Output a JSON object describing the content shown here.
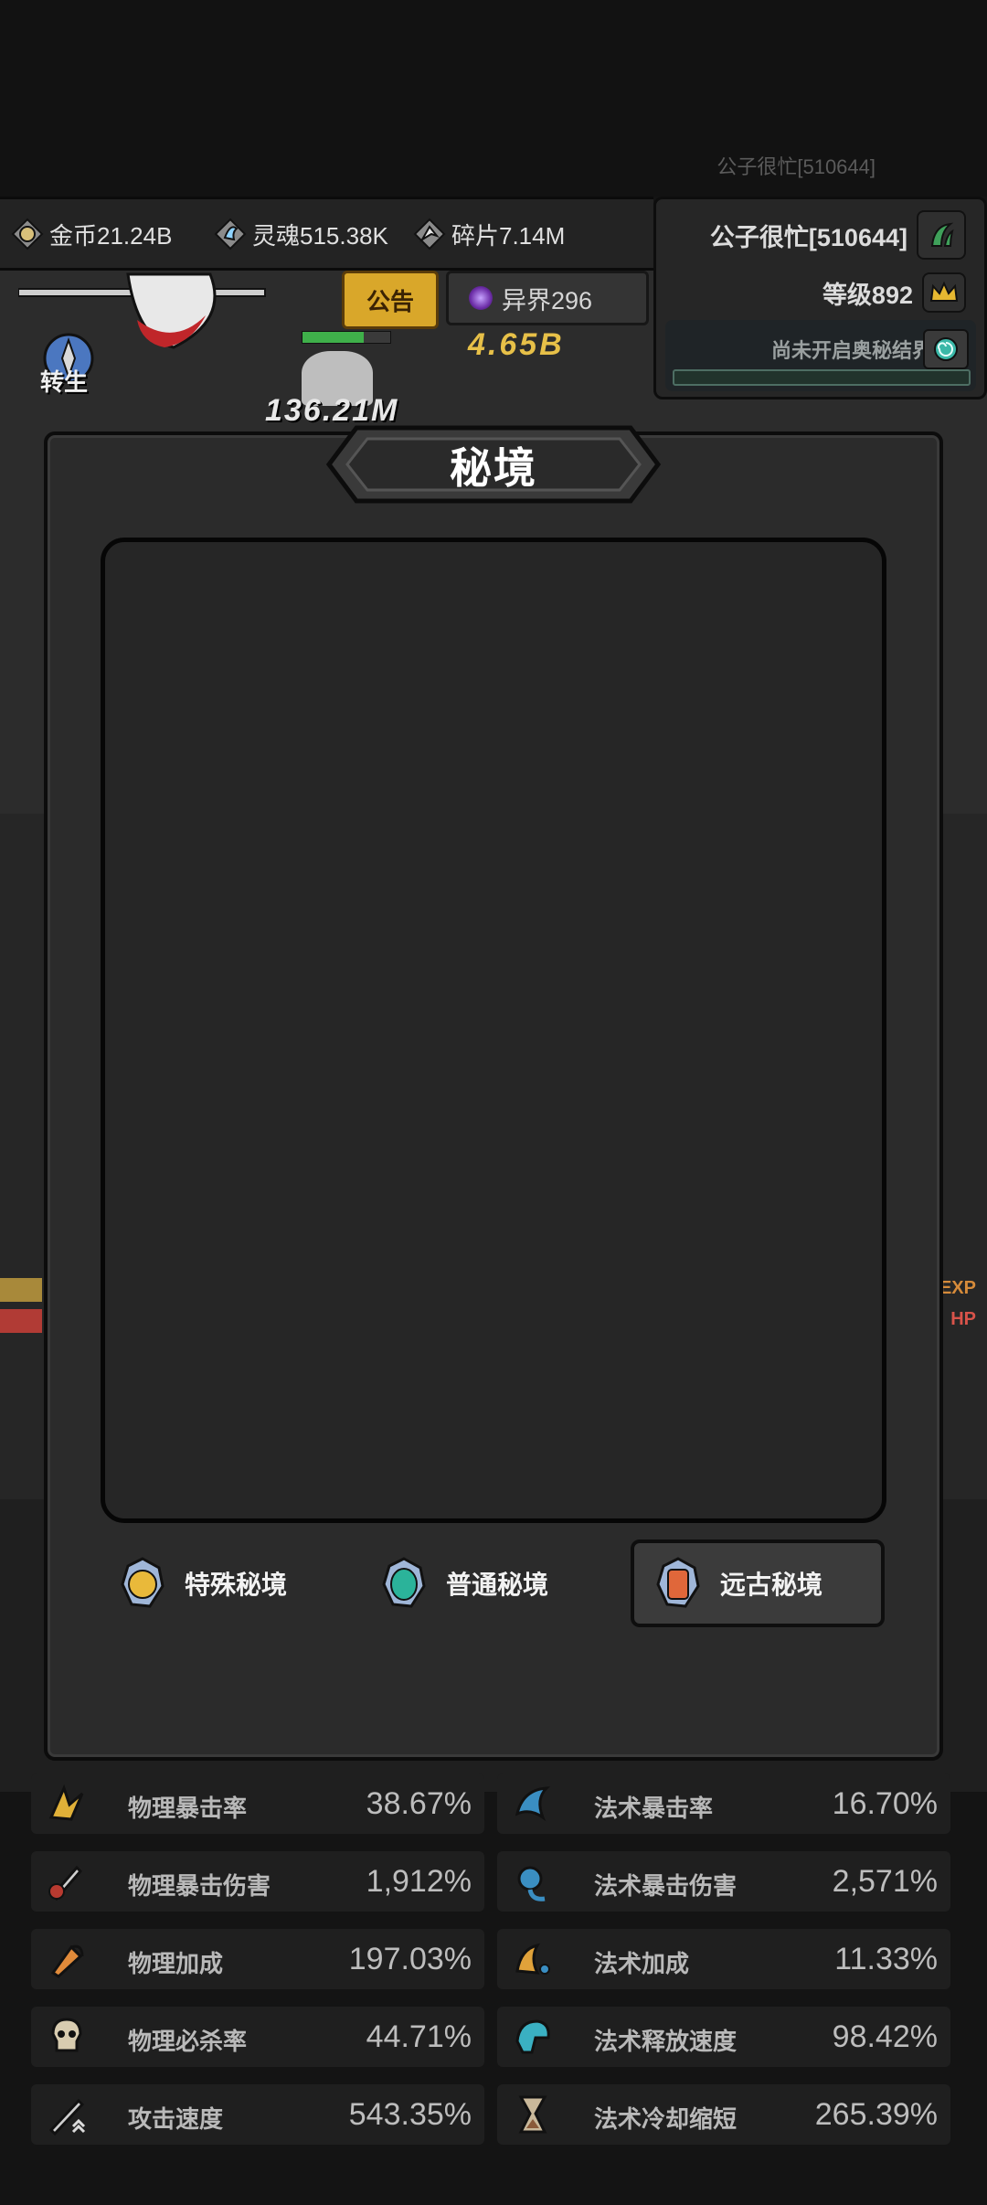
{
  "header": {
    "player_name_faint": "公子很忙[510644]"
  },
  "resources": [
    {
      "name": "gold",
      "label": "金币21.24B",
      "icon": "coin-icon"
    },
    {
      "name": "soul",
      "label": "灵魂515.38K",
      "icon": "soul-icon"
    },
    {
      "name": "shards",
      "label": "碎片7.14M",
      "icon": "shard-icon"
    }
  ],
  "player_panel": {
    "name": "公子很忙[510644]",
    "level": "等级892",
    "secret_realm_status": "尚未开启奥秘结界"
  },
  "scene": {
    "notice_label": "公告",
    "otherworld_label": "异界296",
    "damage_number": "4.65B",
    "big_damage": "136.21M",
    "rebirth_label": "转生",
    "exp_label": "EXP",
    "hp_label": "HP"
  },
  "modal": {
    "title": "秘境",
    "tabs": [
      {
        "label": "特殊秘境",
        "gem": "gold",
        "selected": false
      },
      {
        "label": "普通秘境",
        "gem": "teal",
        "selected": false
      },
      {
        "label": "远古秘境",
        "gem": "orange",
        "selected": true
      }
    ]
  },
  "stats": [
    {
      "label": "物理暴击率",
      "value": "38.67%",
      "icon": "physical-crit-icon"
    },
    {
      "label": "法术暴击率",
      "value": "16.70%",
      "icon": "spell-crit-icon"
    },
    {
      "label": "物理暴击伤害",
      "value": "1,912%",
      "icon": "physical-crit-damage-icon"
    },
    {
      "label": "法术暴击伤害",
      "value": "2,571%",
      "icon": "spell-crit-damage-icon"
    },
    {
      "label": "物理加成",
      "value": "197.03%",
      "icon": "physical-bonus-icon"
    },
    {
      "label": "法术加成",
      "value": "11.33%",
      "icon": "spell-bonus-icon"
    },
    {
      "label": "物理必杀率",
      "value": "44.71%",
      "icon": "skull-icon"
    },
    {
      "label": "法术释放速度",
      "value": "98.42%",
      "icon": "cast-speed-icon"
    },
    {
      "label": "攻击速度",
      "value": "543.35%",
      "icon": "attack-speed-icon"
    },
    {
      "label": "法术冷却缩短",
      "value": "265.39%",
      "icon": "hourglass-icon"
    }
  ],
  "colors": {
    "gold": "#e9b93a",
    "teal": "#2bb39a",
    "orange": "#e0673a",
    "panel": "#2b2b2b"
  }
}
